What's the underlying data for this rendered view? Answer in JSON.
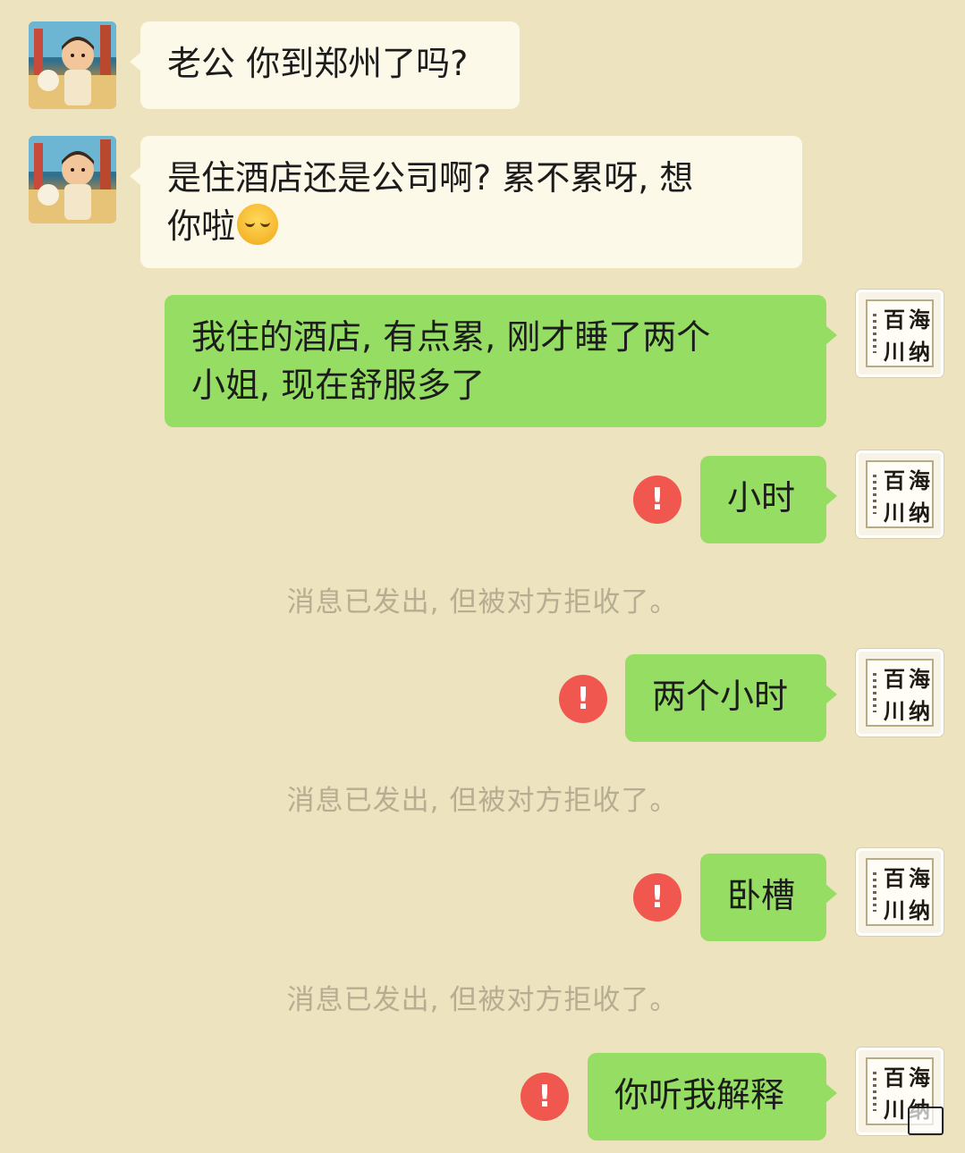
{
  "messages": [
    {
      "side": "in",
      "text": "老公 你到郑州了吗?"
    },
    {
      "side": "in",
      "text": "是住酒店还是公司啊? 累不累呀, 想",
      "text2": "你啦",
      "emoji": "smiling-face-emoji"
    },
    {
      "side": "out",
      "line1": "我住的酒店, 有点累, 刚才睡了两个",
      "line2": "小姐, 现在舒服多了"
    },
    {
      "side": "out",
      "text": "小时",
      "failed": true
    },
    {
      "side": "out",
      "text": "两个小时",
      "failed": true
    },
    {
      "side": "out",
      "text": "卧槽",
      "failed": true
    },
    {
      "side": "out",
      "text": "你听我解释",
      "failed": true
    }
  ],
  "system_notice": "消息已发出, 但被对方拒收了。",
  "self_avatar": {
    "chars": [
      "百",
      "海",
      "川",
      "纳"
    ]
  },
  "error_glyph": "!",
  "colors": {
    "background": "#ede3bf",
    "incoming_bubble": "#fdf9e9",
    "outgoing_bubble": "#95dd63",
    "error": "#f0574f",
    "notice_text": "#b6ad92"
  }
}
